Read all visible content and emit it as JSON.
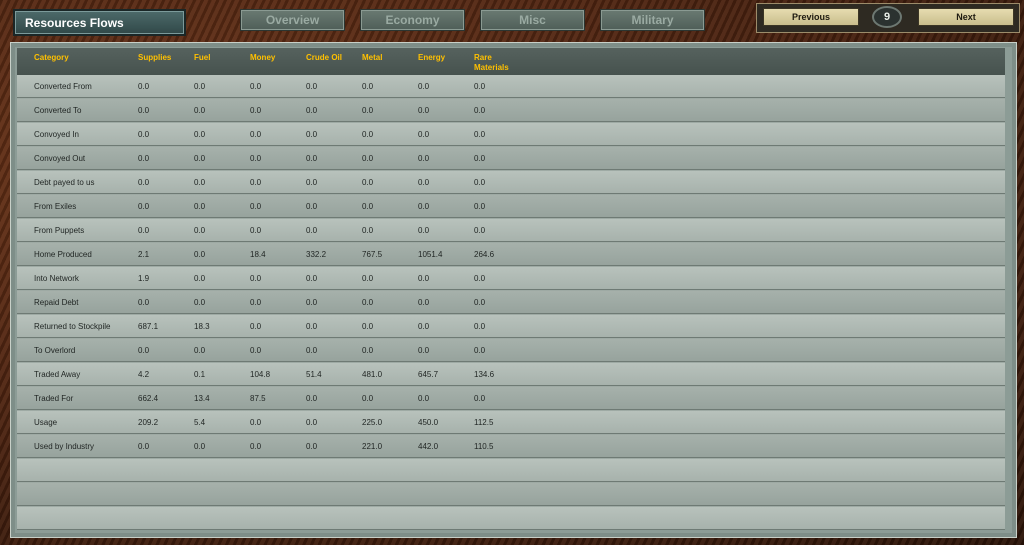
{
  "panel_title": "Resources Flows",
  "tabs": [
    {
      "label": "Overview"
    },
    {
      "label": "Economy"
    },
    {
      "label": "Misc"
    },
    {
      "label": "Military"
    }
  ],
  "nav": {
    "previous_label": "Previous",
    "page_number": "9",
    "next_label": "Next"
  },
  "table": {
    "headers": [
      "Category",
      "Supplies",
      "Fuel",
      "Money",
      "Crude Oil",
      "Metal",
      "Energy",
      "Rare Materials"
    ],
    "rows": [
      [
        "Converted From",
        "0.0",
        "0.0",
        "0.0",
        "0.0",
        "0.0",
        "0.0",
        "0.0"
      ],
      [
        "Converted To",
        "0.0",
        "0.0",
        "0.0",
        "0.0",
        "0.0",
        "0.0",
        "0.0"
      ],
      [
        "Convoyed In",
        "0.0",
        "0.0",
        "0.0",
        "0.0",
        "0.0",
        "0.0",
        "0.0"
      ],
      [
        "Convoyed Out",
        "0.0",
        "0.0",
        "0.0",
        "0.0",
        "0.0",
        "0.0",
        "0.0"
      ],
      [
        "Debt payed to us",
        "0.0",
        "0.0",
        "0.0",
        "0.0",
        "0.0",
        "0.0",
        "0.0"
      ],
      [
        "From Exiles",
        "0.0",
        "0.0",
        "0.0",
        "0.0",
        "0.0",
        "0.0",
        "0.0"
      ],
      [
        "From Puppets",
        "0.0",
        "0.0",
        "0.0",
        "0.0",
        "0.0",
        "0.0",
        "0.0"
      ],
      [
        "Home Produced",
        "2.1",
        "0.0",
        "18.4",
        "332.2",
        "767.5",
        "1051.4",
        "264.6"
      ],
      [
        "Into Network",
        "1.9",
        "0.0",
        "0.0",
        "0.0",
        "0.0",
        "0.0",
        "0.0"
      ],
      [
        "Repaid Debt",
        "0.0",
        "0.0",
        "0.0",
        "0.0",
        "0.0",
        "0.0",
        "0.0"
      ],
      [
        "Returned to Stockpile",
        "687.1",
        "18.3",
        "0.0",
        "0.0",
        "0.0",
        "0.0",
        "0.0"
      ],
      [
        "To Overlord",
        "0.0",
        "0.0",
        "0.0",
        "0.0",
        "0.0",
        "0.0",
        "0.0"
      ],
      [
        "Traded Away",
        "4.2",
        "0.1",
        "104.8",
        "51.4",
        "481.0",
        "645.7",
        "134.6"
      ],
      [
        "Traded For",
        "662.4",
        "13.4",
        "87.5",
        "0.0",
        "0.0",
        "0.0",
        "0.0"
      ],
      [
        "Usage",
        "209.2",
        "5.4",
        "0.0",
        "0.0",
        "225.0",
        "450.0",
        "112.5"
      ],
      [
        "Used by Industry",
        "0.0",
        "0.0",
        "0.0",
        "0.0",
        "221.0",
        "442.0",
        "110.5"
      ],
      [
        "",
        "",
        "",
        "",
        "",
        "",
        "",
        ""
      ],
      [
        "",
        "",
        "",
        "",
        "",
        "",
        "",
        ""
      ],
      [
        "",
        "",
        "",
        "",
        "",
        "",
        "",
        ""
      ]
    ]
  },
  "colors": {
    "header_text": "#ffc000",
    "title_text": "#ffffff",
    "nav_button": "#e6dcb0"
  }
}
